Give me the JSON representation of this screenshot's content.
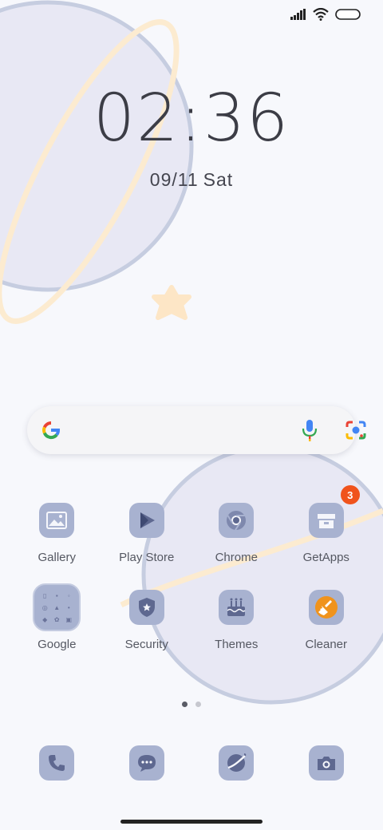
{
  "status_bar": {
    "signal_icon": "cellular-signal-icon",
    "wifi_icon": "wifi-icon",
    "battery_icon": "battery-icon"
  },
  "clock": {
    "time": "02:36",
    "date": "09/11",
    "day": "Sat"
  },
  "search": {
    "logo_icon": "google-g-icon",
    "voice_icon": "microphone-icon",
    "lens_icon": "camera-lens-icon"
  },
  "apps": [
    {
      "label": "Gallery",
      "icon": "gallery-icon"
    },
    {
      "label": "Play Store",
      "icon": "play-store-icon"
    },
    {
      "label": "Chrome",
      "icon": "chrome-icon"
    },
    {
      "label": "GetApps",
      "icon": "getapps-icon",
      "badge": "3"
    },
    {
      "label": "Google",
      "icon": "google-folder-icon"
    },
    {
      "label": "Security",
      "icon": "security-icon"
    },
    {
      "label": "Themes",
      "icon": "themes-icon"
    },
    {
      "label": "Cleaner",
      "icon": "cleaner-icon"
    }
  ],
  "page_indicator": {
    "pages": 2,
    "current": 1
  },
  "dock": [
    {
      "icon": "phone-icon"
    },
    {
      "icon": "messages-icon"
    },
    {
      "icon": "browser-icon"
    },
    {
      "icon": "camera-icon"
    }
  ],
  "colors": {
    "background": "#f7f8fc",
    "planet_fill": "#e8e8f4",
    "planet_outline": "#c6cde0",
    "ring": "#fcebd0",
    "icon_tint": "#a8b2d0",
    "badge": "#f0531c",
    "cleaner_accent": "#f0931c"
  }
}
